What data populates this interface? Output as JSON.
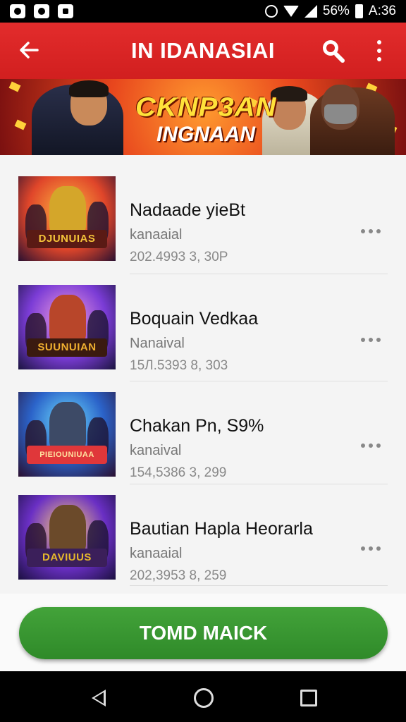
{
  "status_bar": {
    "battery": "56%",
    "time": "A:36"
  },
  "app_bar": {
    "title": "IN IDANASIAI"
  },
  "banner": {
    "title": "CKNP3AN",
    "subtitle": "INGNAAN"
  },
  "games": [
    {
      "title": "Nadaade yieBt",
      "subtitle": "kanaaial",
      "meta": "202.4993 3, 30P",
      "thumb_label": "DJUNUIAS",
      "colors": {
        "glow": "#e0462a",
        "char": "#d4a62a",
        "logo": "#f3c23a"
      }
    },
    {
      "title": "Boquain Vedkaa",
      "subtitle": "Nanaival",
      "meta": "15Л.5393 8, 303",
      "thumb_label": "SUUNUIAN",
      "colors": {
        "glow": "#7b3cd6",
        "char": "#b8462a",
        "logo": "#f0b030"
      }
    },
    {
      "title": "Chakan Pn, S9%",
      "subtitle": "kanaival",
      "meta": "154,5386 3, 299",
      "thumb_label": "PIEIOUNIUAA",
      "colors": {
        "glow": "#2b63c9",
        "char": "#3d4a66",
        "logo": "#e0373a"
      }
    },
    {
      "title": "Bautian Hapla Heorarla",
      "subtitle": "kanaaial",
      "meta": "202,3953 8, 259",
      "thumb_label": "DAVIUUS",
      "colors": {
        "glow": "#6a2fc4",
        "char": "#6b4a2a",
        "logo": "#e6b82c"
      }
    }
  ],
  "cta": {
    "label": "TOMD MAICK"
  }
}
